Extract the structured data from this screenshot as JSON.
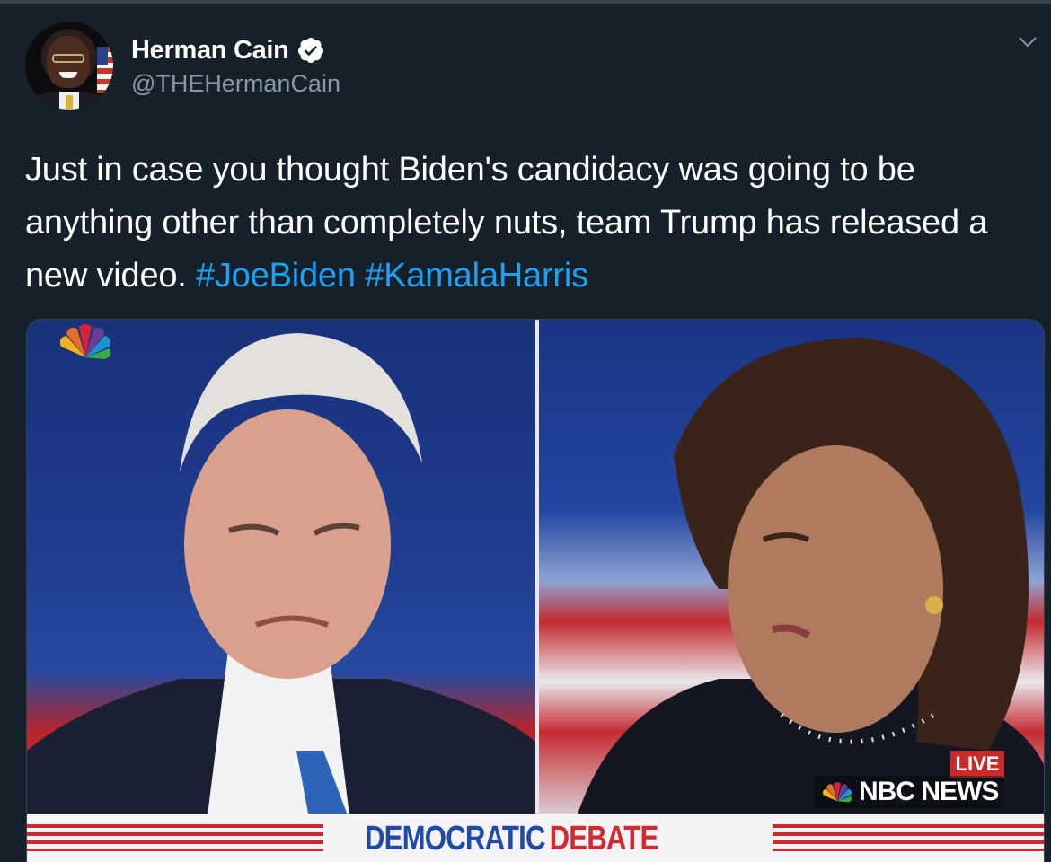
{
  "author": {
    "name": "Herman Cain",
    "handle": "@THEHermanCain",
    "verified": true
  },
  "tweet": {
    "text": "Just in case you thought Biden's candidacy was going to be anything other than completely nuts, team Trump has released a new video.",
    "hashtags": [
      "#JoeBiden",
      "#KamalaHarris"
    ]
  },
  "media": {
    "banner_word_1": "DEMOCRATIC",
    "banner_word_2": "DEBATE",
    "live_label": "LIVE",
    "network_label": "NBC NEWS"
  },
  "icons": {
    "verified": "verified-badge-icon",
    "menu": "chevron-down-icon",
    "network_logo": "nbc-peacock-icon"
  },
  "colors": {
    "background": "#15202b",
    "link": "#1da1f2",
    "secondary_text": "#8899a6",
    "banner_blue": "#1f4aa8",
    "banner_red": "#d12a2f"
  }
}
